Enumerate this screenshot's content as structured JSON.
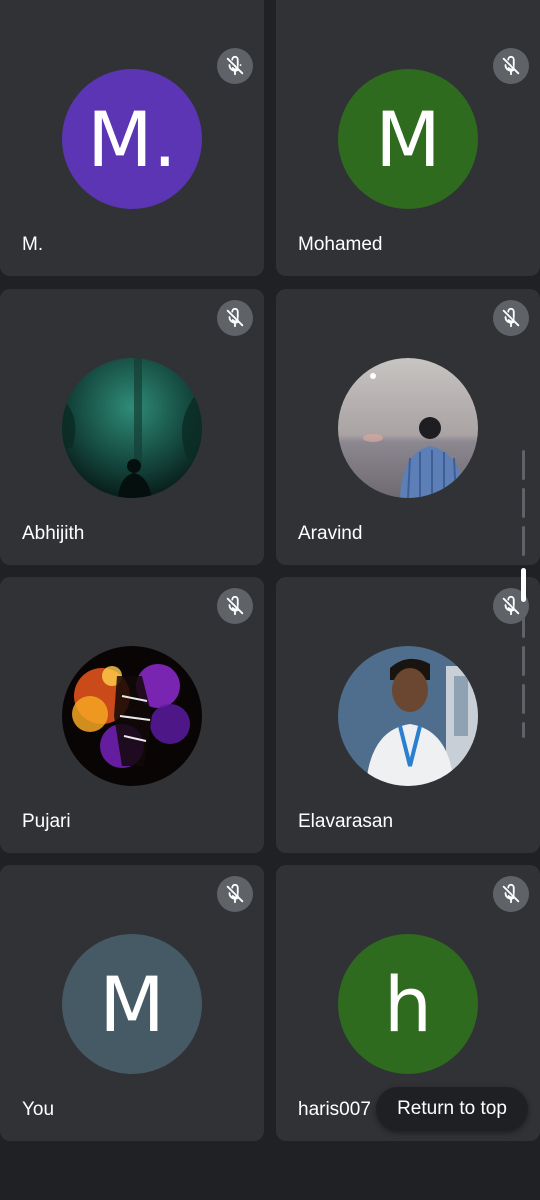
{
  "participants": [
    {
      "name": "M.",
      "initial": "M.",
      "avatar_type": "initial",
      "avatar_color": "#5c35b5",
      "muted": true
    },
    {
      "name": "Mohamed",
      "initial": "M",
      "avatar_type": "initial",
      "avatar_color": "#2e6b1f",
      "muted": true
    },
    {
      "name": "Abhijith",
      "avatar_type": "photo",
      "photo_desc": "forest-silhouette",
      "muted": true
    },
    {
      "name": "Aravind",
      "avatar_type": "photo",
      "photo_desc": "beach-person",
      "muted": true
    },
    {
      "name": "Pujari",
      "avatar_type": "photo",
      "photo_desc": "fire-art",
      "muted": true
    },
    {
      "name": "Elavarasan",
      "avatar_type": "photo",
      "photo_desc": "portrait",
      "muted": true
    },
    {
      "name": "You",
      "initial": "M",
      "avatar_type": "initial",
      "avatar_color": "#455a64",
      "muted": true
    },
    {
      "name": "haris007",
      "initial": "h",
      "avatar_type": "initial",
      "avatar_color": "#2e6b1f",
      "muted": true
    }
  ],
  "return_button": {
    "label": "Return to top"
  },
  "icons": {
    "mute": "mic-off-icon"
  },
  "colors": {
    "background": "#202124",
    "tile": "#313236",
    "mute_badge": "#5f6368"
  }
}
